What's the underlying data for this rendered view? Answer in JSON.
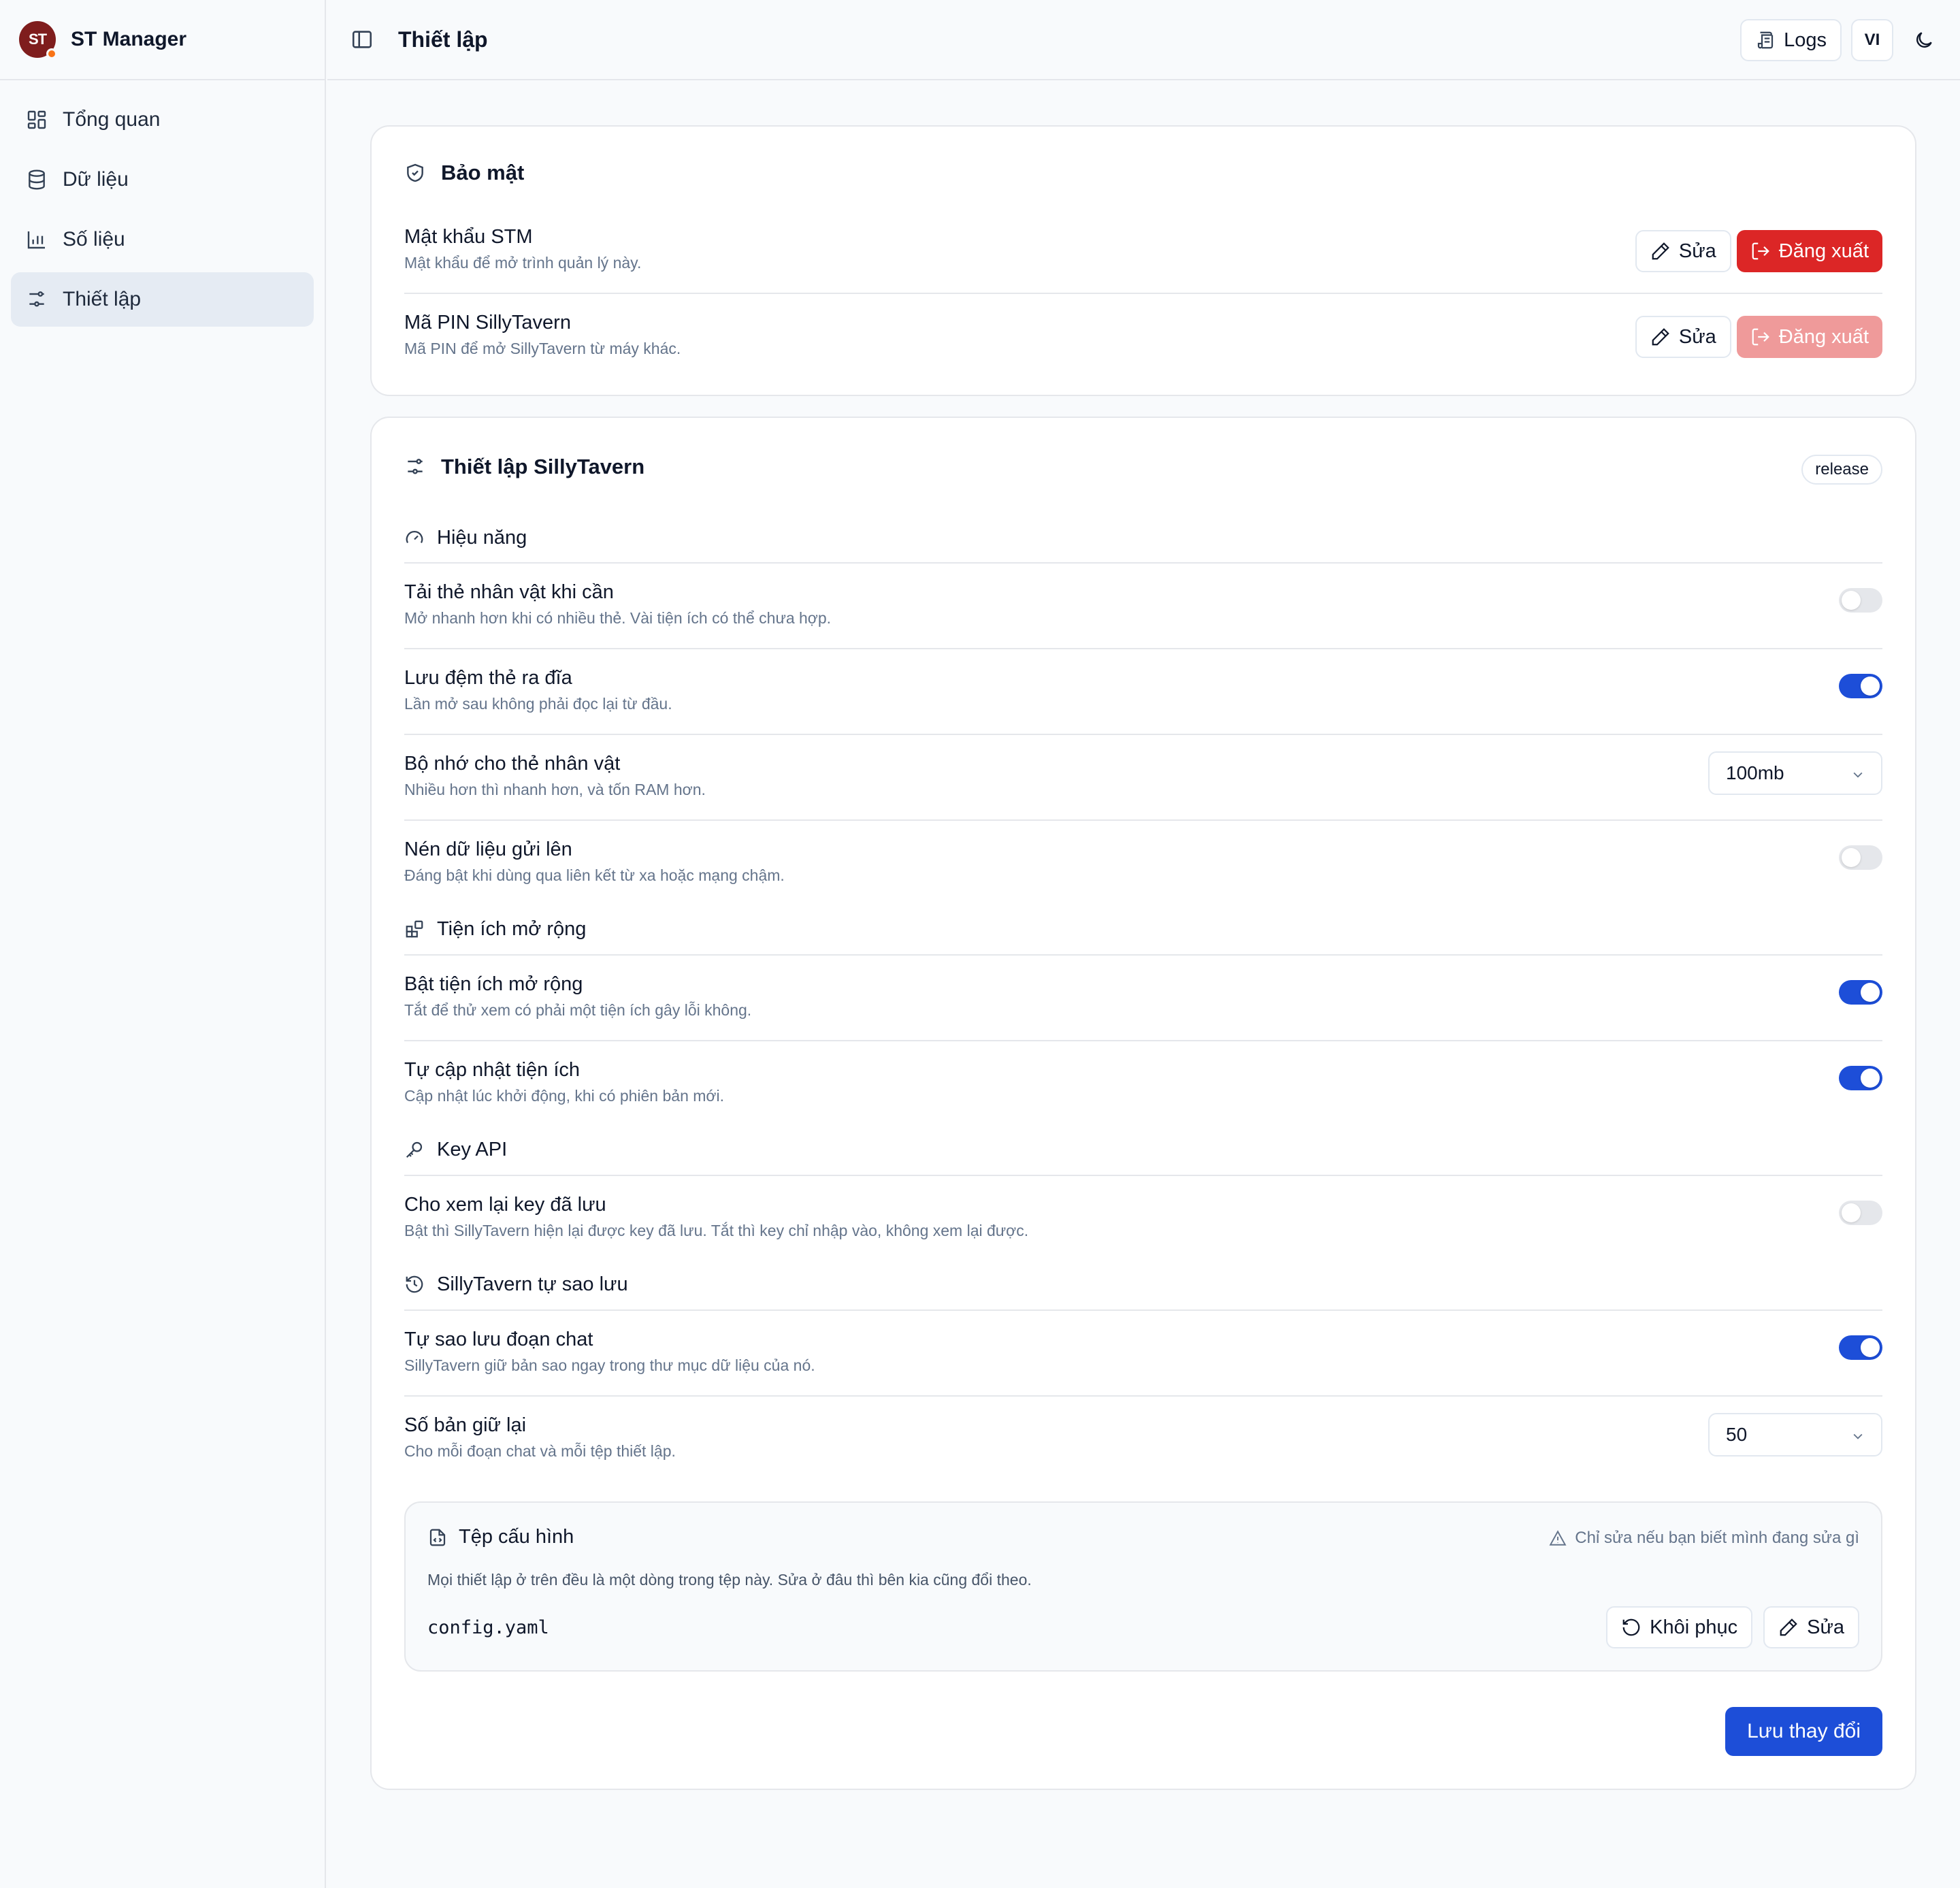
{
  "app": {
    "logo_text": "ST",
    "name": "ST Manager"
  },
  "sidebar": {
    "items": [
      {
        "label": "Tổng quan",
        "icon": "dashboard-icon"
      },
      {
        "label": "Dữ liệu",
        "icon": "database-icon"
      },
      {
        "label": "Số liệu",
        "icon": "bar-chart-icon"
      },
      {
        "label": "Thiết lập",
        "icon": "settings-sliders-icon",
        "active": true
      }
    ]
  },
  "topbar": {
    "title": "Thiết lập",
    "logs_label": "Logs",
    "lang_label": "VI"
  },
  "security": {
    "title": "Bảo mật",
    "rows": [
      {
        "title": "Mật khẩu STM",
        "desc": "Mật khẩu để mở trình quản lý này.",
        "edit": "Sửa",
        "logout": "Đăng xuất",
        "logout_enabled": true
      },
      {
        "title": "Mã PIN SillyTavern",
        "desc": "Mã PIN để mở SillyTavern từ máy khác.",
        "edit": "Sửa",
        "logout": "Đăng xuất",
        "logout_enabled": false
      }
    ]
  },
  "st_settings": {
    "title": "Thiết lập SillyTavern",
    "badge": "release",
    "sections": {
      "performance": "Hiệu năng",
      "extensions": "Tiện ích mở rộng",
      "api": "Key API",
      "backup": "SillyTavern tự sao lưu"
    },
    "rows": {
      "lazy": {
        "title": "Tải thẻ nhân vật khi cần",
        "desc": "Mở nhanh hơn khi có nhiều thẻ. Vài tiện ích có thể chưa hợp.",
        "on": false
      },
      "cache": {
        "title": "Lưu đệm thẻ ra đĩa",
        "desc": "Lần mở sau không phải đọc lại từ đầu.",
        "on": true
      },
      "memory": {
        "title": "Bộ nhớ cho thẻ nhân vật",
        "desc": "Nhiều hơn thì nhanh hơn, và tốn RAM hơn.",
        "value": "100mb"
      },
      "compress": {
        "title": "Nén dữ liệu gửi lên",
        "desc": "Đáng bật khi dùng qua liên kết từ xa hoặc mạng chậm.",
        "on": false
      },
      "enable_ext": {
        "title": "Bật tiện ích mở rộng",
        "desc": "Tắt để thử xem có phải một tiện ích gây lỗi không.",
        "on": true
      },
      "auto_update": {
        "title": "Tự cập nhật tiện ích",
        "desc": "Cập nhật lúc khởi động, khi có phiên bản mới.",
        "on": true
      },
      "show_keys": {
        "title": "Cho xem lại key đã lưu",
        "desc": "Bật thì SillyTavern hiện lại được key đã lưu. Tắt thì key chỉ nhập vào, không xem lại được.",
        "on": false
      },
      "auto_backup": {
        "title": "Tự sao lưu đoạn chat",
        "desc": "SillyTavern giữ bản sao ngay trong thư mục dữ liệu của nó.",
        "on": true
      },
      "keep_count": {
        "title": "Số bản giữ lại",
        "desc": "Cho mỗi đoạn chat và mỗi tệp thiết lập.",
        "value": "50"
      }
    },
    "config": {
      "title": "Tệp cấu hình",
      "warning": "Chỉ sửa nếu bạn biết mình đang sửa gì",
      "desc": "Mọi thiết lập ở trên đều là một dòng trong tệp này. Sửa ở đâu thì bên kia cũng đổi theo.",
      "filename": "config.yaml",
      "restore": "Khôi phục",
      "edit": "Sửa"
    },
    "save_label": "Lưu thay đổi"
  },
  "colors": {
    "accent": "#1d4ed8",
    "danger": "#dc2626",
    "danger_disabled": "#ef9a9a",
    "logo_bg": "#7f1d1d"
  }
}
